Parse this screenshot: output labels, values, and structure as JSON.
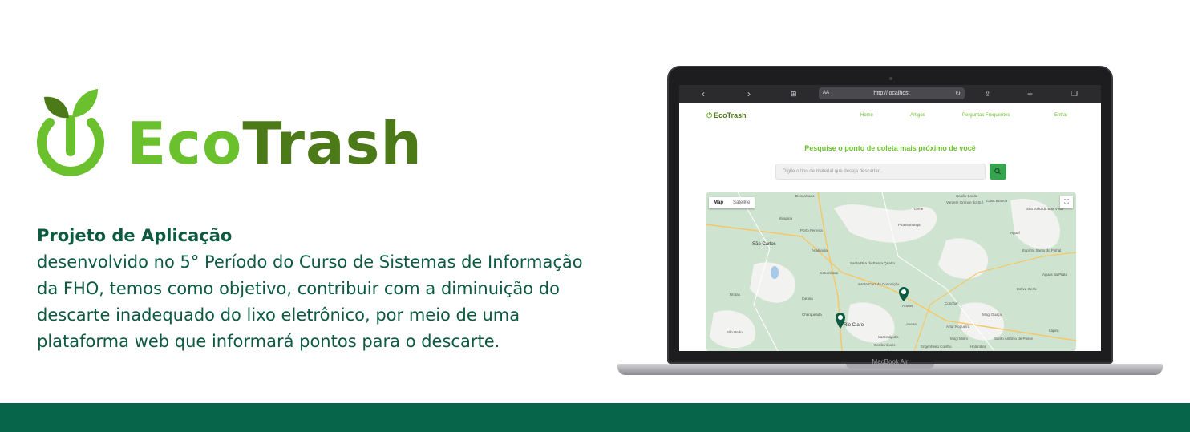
{
  "brand": {
    "part1": "Eco",
    "part2": "Trash",
    "colors": {
      "light_green": "#6ac02d",
      "dark_green": "#4d7a18",
      "footer": "#076549",
      "text": "#0c5a40"
    }
  },
  "description": {
    "title": "Projeto de Aplicação",
    "body": "desenvolvido no 5° Período do Curso de Sistemas de Informação da FHO, temos como objetivo, contribuir com a diminuição do descarte inadequado do lixo eletrônico, por meio de uma plataforma web que informará pontos para o descarte."
  },
  "laptop": {
    "model_label": "MacBook Air"
  },
  "browser": {
    "url": "http://localhost",
    "aa_label": "AA",
    "icons": [
      "back-icon",
      "forward-icon",
      "book-icon",
      "share-icon",
      "plus-icon",
      "tabs-icon",
      "reload-icon",
      "lock-icon"
    ]
  },
  "site": {
    "logo_text": "EcoTrash",
    "nav": [
      "Home",
      "Artigos",
      "Perguntas Frequentes",
      "Entrar"
    ],
    "headline": "Pesquise o ponto de coleta mais próximo de você",
    "search_placeholder": "Digite o tipo de material que deseja descartar...",
    "map": {
      "type_controls": [
        "Map",
        "Satellite"
      ],
      "labels": [
        "Descalvado",
        "Capão Bonito",
        "Santa Rita do Passa Quatro",
        "São Carlos",
        "Porto Ferreira",
        "Pirassununga",
        "Rio Claro",
        "Araras",
        "Leme",
        "Limeira",
        "Mogi Guaçu",
        "Mogi Mirim",
        "Corumbataí",
        "Analândia",
        "Itirapina",
        "Ipeúna",
        "Cordeirópolis",
        "Conchal",
        "Aguaí",
        "São João da Boa Vista",
        "Espírito Santo do Pinhal",
        "Estiva Gerbi",
        "Itapira",
        "Engenheiro Coelho",
        "Artur Nogueira",
        "Santo Antônio de Posse",
        "Holambra",
        "Casa Branca",
        "Vargem Grande do Sul",
        "Águas da Prata",
        "Santa Cruz da Conceição",
        "Brotas",
        "São Pedro",
        "Charqueada",
        "Iracemápolis"
      ]
    }
  }
}
